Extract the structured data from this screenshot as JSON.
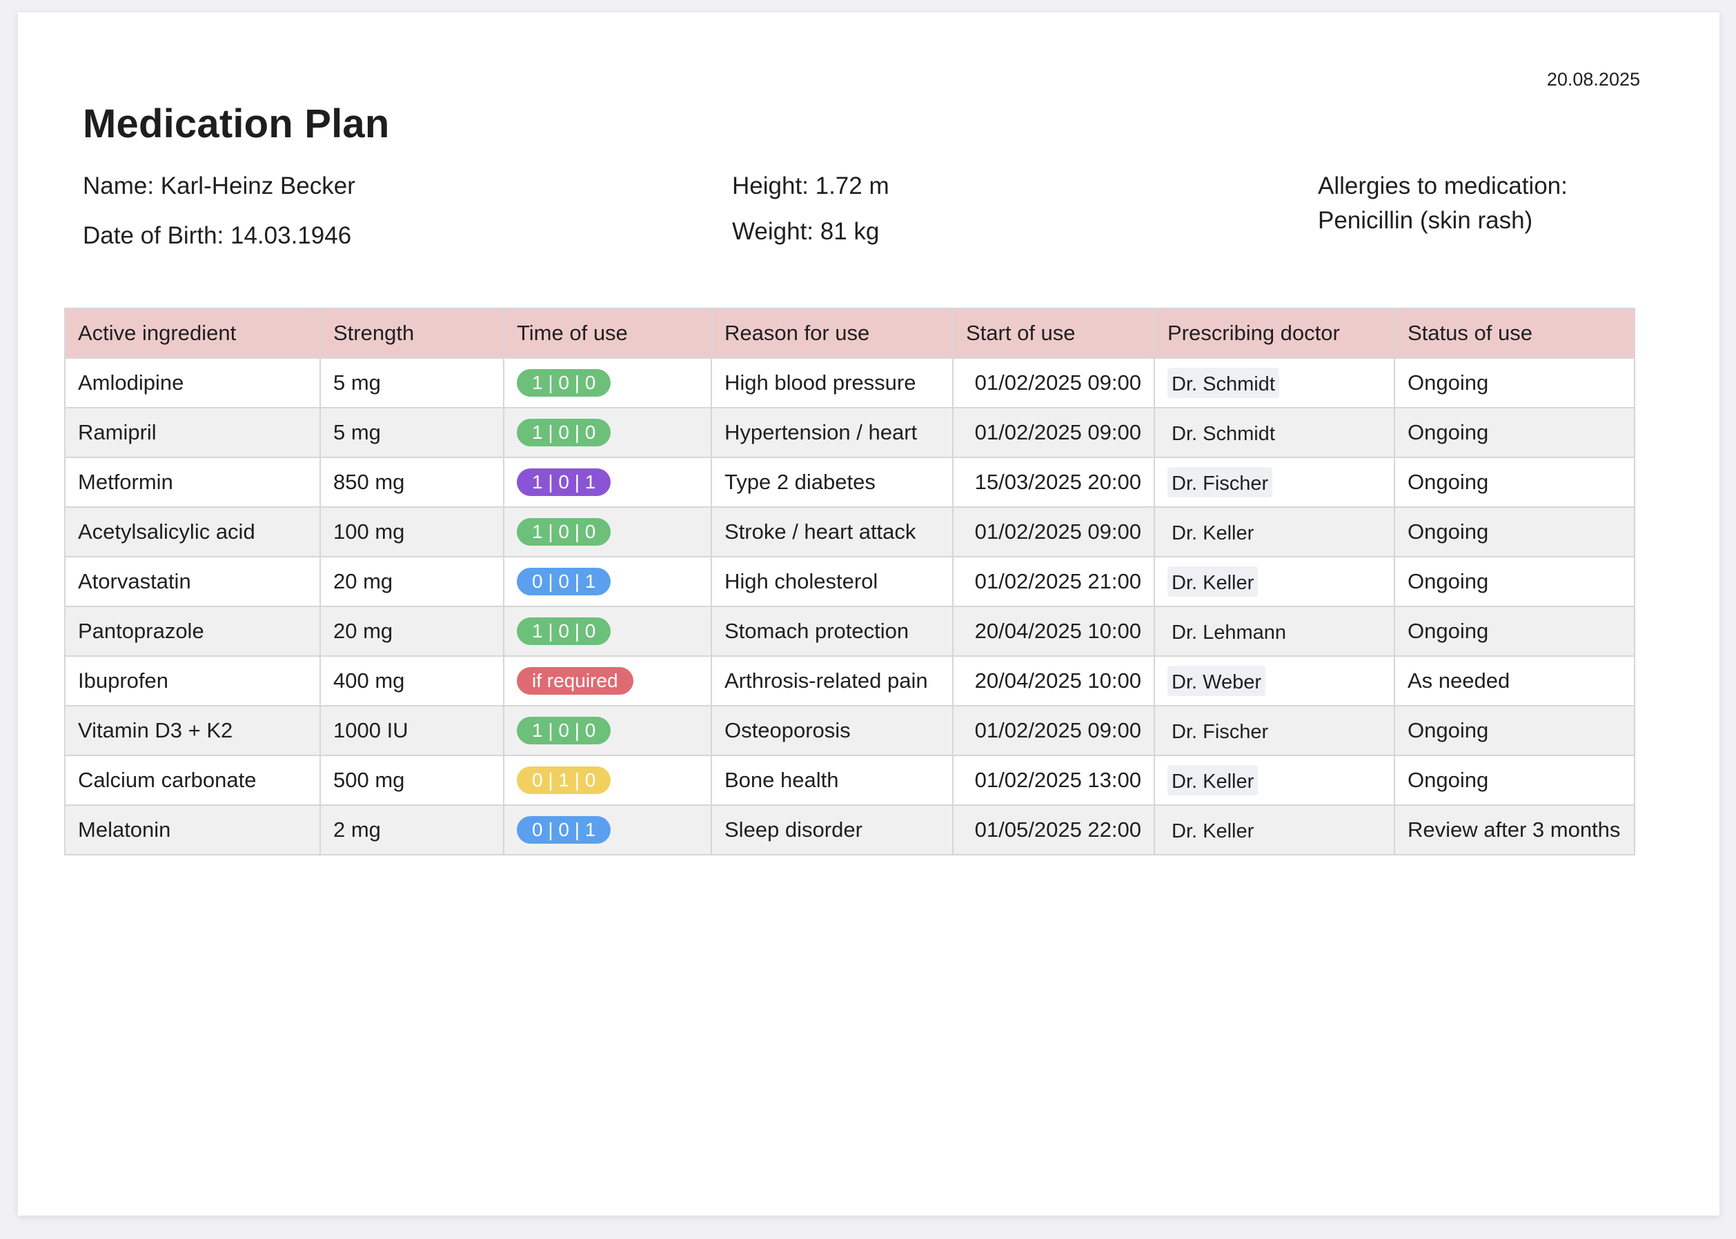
{
  "document": {
    "date": "20.08.2025",
    "title": "Medication Plan"
  },
  "patient": {
    "name": "Name: Karl-Heinz Becker",
    "dob": "Date of Birth: 14.03.1946",
    "height": "Height: 1.72 m",
    "weight": "Weight: 81 kg",
    "allergies_label": "Allergies to medication:",
    "allergies_value": "Penicillin (skin rash)"
  },
  "table": {
    "headers": [
      "Active ingredient",
      "Strength",
      "Time of use",
      "Reason for use",
      "Start of use",
      "Prescribing doctor",
      "Status of use"
    ],
    "rows": [
      {
        "ingredient": "Amlodipine",
        "strength": "5 mg",
        "time": "1 | 0 | 0",
        "time_color": "#6cc07a",
        "reason": "High blood pressure",
        "start": "01/02/2025 09:00",
        "doctor": "Dr. Schmidt",
        "status": "Ongoing"
      },
      {
        "ingredient": "Ramipril",
        "strength": "5 mg",
        "time": "1 | 0 | 0",
        "time_color": "#6cc07a",
        "reason": "Hypertension / heart",
        "start": "01/02/2025 09:00",
        "doctor": "Dr. Schmidt",
        "status": "Ongoing"
      },
      {
        "ingredient": "Metformin",
        "strength": "850 mg",
        "time": "1 | 0 | 1",
        "time_color": "#8a55d4",
        "reason": "Type 2 diabetes",
        "start": "15/03/2025 20:00",
        "doctor": "Dr. Fischer",
        "status": "Ongoing"
      },
      {
        "ingredient": "Acetylsalicylic acid",
        "strength": "100 mg",
        "time": "1 | 0 | 0",
        "time_color": "#6cc07a",
        "reason": "Stroke / heart attack",
        "start": "01/02/2025 09:00",
        "doctor": "Dr. Keller",
        "status": "Ongoing"
      },
      {
        "ingredient": "Atorvastatin",
        "strength": "20 mg",
        "time": "0 | 0 | 1",
        "time_color": "#5aa0ee",
        "reason": "High cholesterol",
        "start": "01/02/2025 21:00",
        "doctor": "Dr. Keller",
        "status": "Ongoing"
      },
      {
        "ingredient": "Pantoprazole",
        "strength": "20 mg",
        "time": "1 | 0 | 0",
        "time_color": "#6cc07a",
        "reason": "Stomach protection",
        "start": "20/04/2025 10:00",
        "doctor": "Dr. Lehmann",
        "status": "Ongoing"
      },
      {
        "ingredient": "Ibuprofen",
        "strength": "400 mg",
        "time": "if required",
        "time_color": "#e06a72",
        "reason": "Arthrosis-related pain",
        "start": "20/04/2025 10:00",
        "doctor": "Dr. Weber",
        "status": "As needed"
      },
      {
        "ingredient": "Vitamin D3 + K2",
        "strength": "1000 IU",
        "time": "1 | 0 | 0",
        "time_color": "#6cc07a",
        "reason": "Osteoporosis",
        "start": "01/02/2025 09:00",
        "doctor": "Dr. Fischer",
        "status": "Ongoing"
      },
      {
        "ingredient": "Calcium carbonate",
        "strength": "500 mg",
        "time": "0 | 1 | 0",
        "time_color": "#f2d060",
        "reason": "Bone health",
        "start": "01/02/2025 13:00",
        "doctor": "Dr. Keller",
        "status": "Ongoing"
      },
      {
        "ingredient": "Melatonin",
        "strength": "2 mg",
        "time": "0 | 0 | 1",
        "time_color": "#5aa0ee",
        "reason": "Sleep disorder",
        "start": "01/05/2025 22:00",
        "doctor": "Dr. Keller",
        "status": "Review after 3 months"
      }
    ]
  },
  "colors": {
    "header_bg": "#eecbcb",
    "stripe_bg": "#f0f0f0",
    "green_pill": "#6cc07a",
    "purple_pill": "#8a55d4",
    "blue_pill": "#5aa0ee",
    "yellow_pill": "#f2d060",
    "red_pill": "#e06a72"
  }
}
